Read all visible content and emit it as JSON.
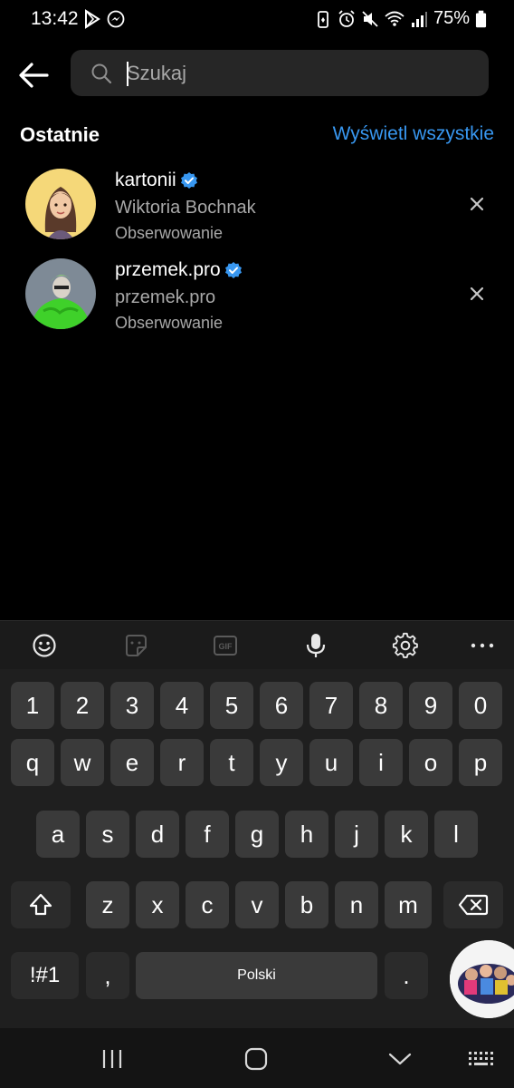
{
  "status_bar": {
    "time": "13:42",
    "battery": "75%",
    "left_icons": [
      "play-store-icon",
      "messenger-icon"
    ],
    "right_icons": [
      "battery-saver-icon",
      "alarm-icon",
      "mute-icon",
      "wifi-icon",
      "signal-icon",
      "battery-icon"
    ]
  },
  "search": {
    "placeholder": "Szukaj",
    "value": ""
  },
  "recent": {
    "title": "Ostatnie",
    "see_all": "Wyświetl wszystkie",
    "items": [
      {
        "username": "kartonii",
        "verified": true,
        "full_name": "Wiktoria Bochnak",
        "relation": "Obserwowanie"
      },
      {
        "username": "przemek.pro",
        "verified": true,
        "full_name": "przemek.pro",
        "relation": "Obserwowanie"
      }
    ]
  },
  "keyboard": {
    "toolbar": [
      "emoji-icon",
      "sticker-icon",
      "gif-icon",
      "microphone-icon",
      "settings-icon",
      "more-icon"
    ],
    "row_numbers": [
      "1",
      "2",
      "3",
      "4",
      "5",
      "6",
      "7",
      "8",
      "9",
      "0"
    ],
    "row_1": [
      "q",
      "w",
      "e",
      "r",
      "t",
      "y",
      "u",
      "i",
      "o",
      "p"
    ],
    "row_2": [
      "a",
      "s",
      "d",
      "f",
      "g",
      "h",
      "j",
      "k",
      "l"
    ],
    "row_3": [
      "z",
      "x",
      "c",
      "v",
      "b",
      "n",
      "m"
    ],
    "symbols_key": "!#1",
    "comma_key": ",",
    "space_label": "Polski",
    "period_key": "."
  },
  "colors": {
    "background": "#000000",
    "accent_link": "#3897f0",
    "verified": "#3897f0",
    "search_field": "#262626",
    "secondary_text": "#a8a8a8"
  }
}
